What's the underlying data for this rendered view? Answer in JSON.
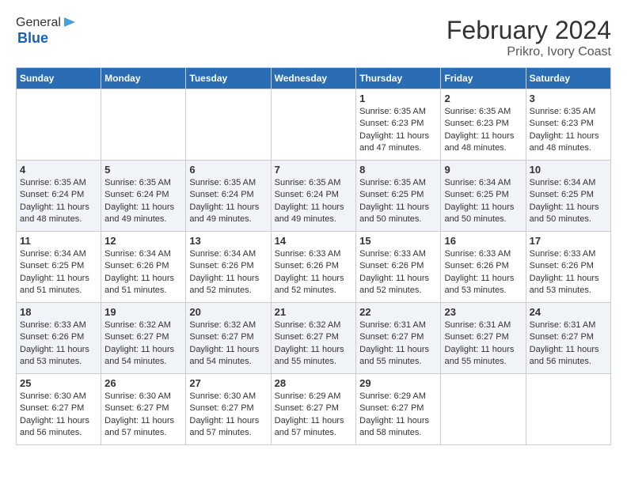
{
  "header": {
    "logo_line1": "General",
    "logo_line2": "Blue",
    "title": "February 2024",
    "subtitle": "Prikro, Ivory Coast"
  },
  "days_of_week": [
    "Sunday",
    "Monday",
    "Tuesday",
    "Wednesday",
    "Thursday",
    "Friday",
    "Saturday"
  ],
  "weeks": [
    [
      {
        "day": "",
        "info": ""
      },
      {
        "day": "",
        "info": ""
      },
      {
        "day": "",
        "info": ""
      },
      {
        "day": "",
        "info": ""
      },
      {
        "day": "1",
        "info": "Sunrise: 6:35 AM\nSunset: 6:23 PM\nDaylight: 11 hours\nand 47 minutes."
      },
      {
        "day": "2",
        "info": "Sunrise: 6:35 AM\nSunset: 6:23 PM\nDaylight: 11 hours\nand 48 minutes."
      },
      {
        "day": "3",
        "info": "Sunrise: 6:35 AM\nSunset: 6:23 PM\nDaylight: 11 hours\nand 48 minutes."
      }
    ],
    [
      {
        "day": "4",
        "info": "Sunrise: 6:35 AM\nSunset: 6:24 PM\nDaylight: 11 hours\nand 48 minutes."
      },
      {
        "day": "5",
        "info": "Sunrise: 6:35 AM\nSunset: 6:24 PM\nDaylight: 11 hours\nand 49 minutes."
      },
      {
        "day": "6",
        "info": "Sunrise: 6:35 AM\nSunset: 6:24 PM\nDaylight: 11 hours\nand 49 minutes."
      },
      {
        "day": "7",
        "info": "Sunrise: 6:35 AM\nSunset: 6:24 PM\nDaylight: 11 hours\nand 49 minutes."
      },
      {
        "day": "8",
        "info": "Sunrise: 6:35 AM\nSunset: 6:25 PM\nDaylight: 11 hours\nand 50 minutes."
      },
      {
        "day": "9",
        "info": "Sunrise: 6:34 AM\nSunset: 6:25 PM\nDaylight: 11 hours\nand 50 minutes."
      },
      {
        "day": "10",
        "info": "Sunrise: 6:34 AM\nSunset: 6:25 PM\nDaylight: 11 hours\nand 50 minutes."
      }
    ],
    [
      {
        "day": "11",
        "info": "Sunrise: 6:34 AM\nSunset: 6:25 PM\nDaylight: 11 hours\nand 51 minutes."
      },
      {
        "day": "12",
        "info": "Sunrise: 6:34 AM\nSunset: 6:26 PM\nDaylight: 11 hours\nand 51 minutes."
      },
      {
        "day": "13",
        "info": "Sunrise: 6:34 AM\nSunset: 6:26 PM\nDaylight: 11 hours\nand 52 minutes."
      },
      {
        "day": "14",
        "info": "Sunrise: 6:33 AM\nSunset: 6:26 PM\nDaylight: 11 hours\nand 52 minutes."
      },
      {
        "day": "15",
        "info": "Sunrise: 6:33 AM\nSunset: 6:26 PM\nDaylight: 11 hours\nand 52 minutes."
      },
      {
        "day": "16",
        "info": "Sunrise: 6:33 AM\nSunset: 6:26 PM\nDaylight: 11 hours\nand 53 minutes."
      },
      {
        "day": "17",
        "info": "Sunrise: 6:33 AM\nSunset: 6:26 PM\nDaylight: 11 hours\nand 53 minutes."
      }
    ],
    [
      {
        "day": "18",
        "info": "Sunrise: 6:33 AM\nSunset: 6:26 PM\nDaylight: 11 hours\nand 53 minutes."
      },
      {
        "day": "19",
        "info": "Sunrise: 6:32 AM\nSunset: 6:27 PM\nDaylight: 11 hours\nand 54 minutes."
      },
      {
        "day": "20",
        "info": "Sunrise: 6:32 AM\nSunset: 6:27 PM\nDaylight: 11 hours\nand 54 minutes."
      },
      {
        "day": "21",
        "info": "Sunrise: 6:32 AM\nSunset: 6:27 PM\nDaylight: 11 hours\nand 55 minutes."
      },
      {
        "day": "22",
        "info": "Sunrise: 6:31 AM\nSunset: 6:27 PM\nDaylight: 11 hours\nand 55 minutes."
      },
      {
        "day": "23",
        "info": "Sunrise: 6:31 AM\nSunset: 6:27 PM\nDaylight: 11 hours\nand 55 minutes."
      },
      {
        "day": "24",
        "info": "Sunrise: 6:31 AM\nSunset: 6:27 PM\nDaylight: 11 hours\nand 56 minutes."
      }
    ],
    [
      {
        "day": "25",
        "info": "Sunrise: 6:30 AM\nSunset: 6:27 PM\nDaylight: 11 hours\nand 56 minutes."
      },
      {
        "day": "26",
        "info": "Sunrise: 6:30 AM\nSunset: 6:27 PM\nDaylight: 11 hours\nand 57 minutes."
      },
      {
        "day": "27",
        "info": "Sunrise: 6:30 AM\nSunset: 6:27 PM\nDaylight: 11 hours\nand 57 minutes."
      },
      {
        "day": "28",
        "info": "Sunrise: 6:29 AM\nSunset: 6:27 PM\nDaylight: 11 hours\nand 57 minutes."
      },
      {
        "day": "29",
        "info": "Sunrise: 6:29 AM\nSunset: 6:27 PM\nDaylight: 11 hours\nand 58 minutes."
      },
      {
        "day": "",
        "info": ""
      },
      {
        "day": "",
        "info": ""
      }
    ]
  ]
}
